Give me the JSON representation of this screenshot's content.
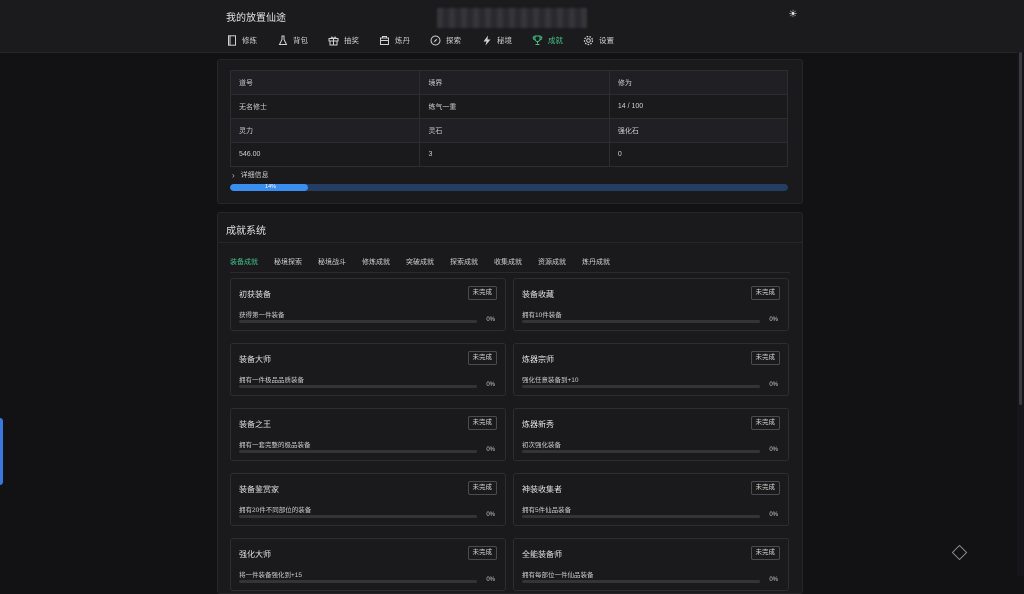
{
  "app": {
    "title": "我的放置仙途",
    "theme_icon": "sun-icon"
  },
  "nav": [
    {
      "label": "修炼",
      "icon": "book-icon",
      "active": false
    },
    {
      "label": "背包",
      "icon": "flask-icon",
      "active": false
    },
    {
      "label": "抽奖",
      "icon": "gift-icon",
      "active": false
    },
    {
      "label": "炼丹",
      "icon": "furnace-icon",
      "active": false
    },
    {
      "label": "探索",
      "icon": "compass-icon",
      "active": false
    },
    {
      "label": "秘境",
      "icon": "lightning-icon",
      "active": false
    },
    {
      "label": "成就",
      "icon": "trophy-icon",
      "active": true
    },
    {
      "label": "设置",
      "icon": "gear-icon",
      "active": false
    }
  ],
  "info": {
    "headers1": [
      "道号",
      "境界",
      "修为"
    ],
    "values1": [
      "无名修士",
      "练气一重",
      "14 / 100"
    ],
    "headers2": [
      "灵力",
      "灵石",
      "强化石"
    ],
    "values2": [
      "546.00",
      "3",
      "0"
    ]
  },
  "detail_label": "详细信息",
  "progress": {
    "percent_label": "14%",
    "fraction": 0.14
  },
  "achievements": {
    "title": "成就系统",
    "tabs": [
      {
        "label": "装备成就",
        "active": true
      },
      {
        "label": "秘境探索",
        "active": false
      },
      {
        "label": "秘境战斗",
        "active": false
      },
      {
        "label": "修炼成就",
        "active": false
      },
      {
        "label": "突破成就",
        "active": false
      },
      {
        "label": "探索成就",
        "active": false
      },
      {
        "label": "收集成就",
        "active": false
      },
      {
        "label": "资源成就",
        "active": false
      },
      {
        "label": "炼丹成就",
        "active": false
      }
    ],
    "items": [
      {
        "name": "初获装备",
        "status": "未完成",
        "desc": "获得第一件装备",
        "pct": "0%",
        "fraction": 0
      },
      {
        "name": "装备收藏",
        "status": "未完成",
        "desc": "拥有10件装备",
        "pct": "0%",
        "fraction": 0
      },
      {
        "name": "装备大师",
        "status": "未完成",
        "desc": "拥有一件极品品质装备",
        "pct": "0%",
        "fraction": 0
      },
      {
        "name": "炼器宗师",
        "status": "未完成",
        "desc": "强化任意装备到+10",
        "pct": "0%",
        "fraction": 0
      },
      {
        "name": "装备之王",
        "status": "未完成",
        "desc": "拥有一套完整的极品装备",
        "pct": "0%",
        "fraction": 0
      },
      {
        "name": "炼器新秀",
        "status": "未完成",
        "desc": "初次强化装备",
        "pct": "0%",
        "fraction": 0
      },
      {
        "name": "装备鉴赏家",
        "status": "未完成",
        "desc": "拥有20件不同部位的装备",
        "pct": "0%",
        "fraction": 0
      },
      {
        "name": "神装收集者",
        "status": "未完成",
        "desc": "拥有5件仙品装备",
        "pct": "0%",
        "fraction": 0
      },
      {
        "name": "强化大师",
        "status": "未完成",
        "desc": "将一件装备强化到+15",
        "pct": "0%",
        "fraction": 0
      },
      {
        "name": "全能装备师",
        "status": "未完成",
        "desc": "拥有每部位一件仙品装备",
        "pct": "0%",
        "fraction": 0
      }
    ]
  },
  "colors": {
    "accent_green": "#45c08a",
    "accent_blue": "#3a8ef0",
    "background": "#121215",
    "panel": "#1a1a1d"
  }
}
